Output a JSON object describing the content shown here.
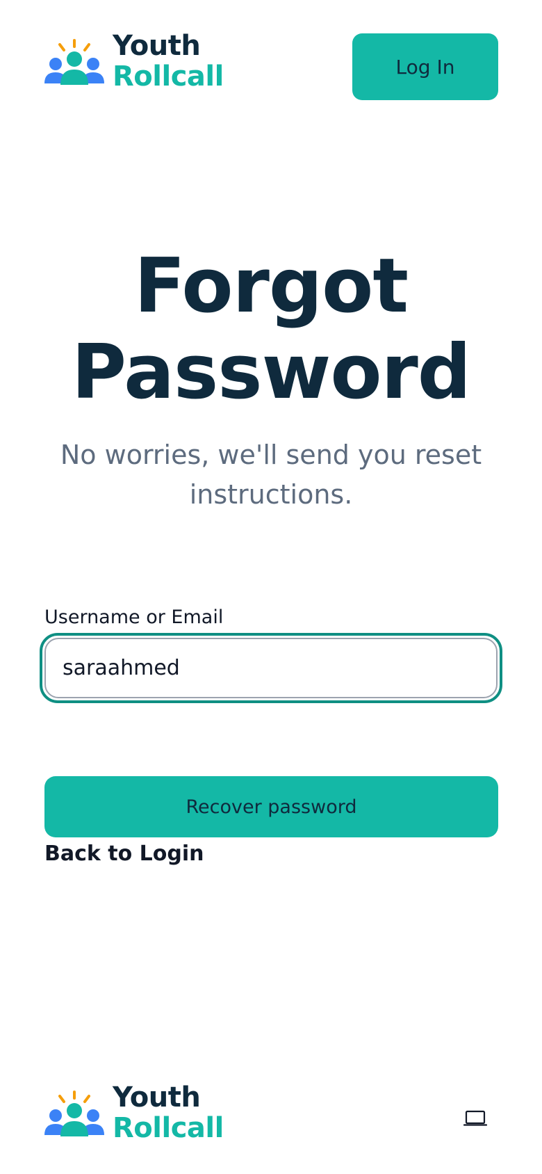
{
  "header": {
    "brand": {
      "line1": "Youth",
      "line2": "Rollcall",
      "logo_icon": "people-group-logo-icon"
    },
    "login_label": "Log In"
  },
  "hero": {
    "title": "Forgot Password",
    "subtitle": "No worries, we'll send you reset instructions."
  },
  "form": {
    "username_label": "Username or Email",
    "username_value": "saraahmed",
    "submit_label": "Recover password",
    "back_label": "Back to Login"
  },
  "footer": {
    "brand": {
      "line1": "Youth",
      "line2": "Rollcall",
      "logo_icon": "people-group-logo-icon"
    },
    "theme_icon": "laptop-icon"
  },
  "colors": {
    "accent": "#14b8a6",
    "focus_ring": "#0f8f83",
    "heading": "#0f2a3d",
    "muted": "#5d6b7e",
    "logo_blue": "#3b82f6",
    "logo_rays": "#f59e0b"
  }
}
